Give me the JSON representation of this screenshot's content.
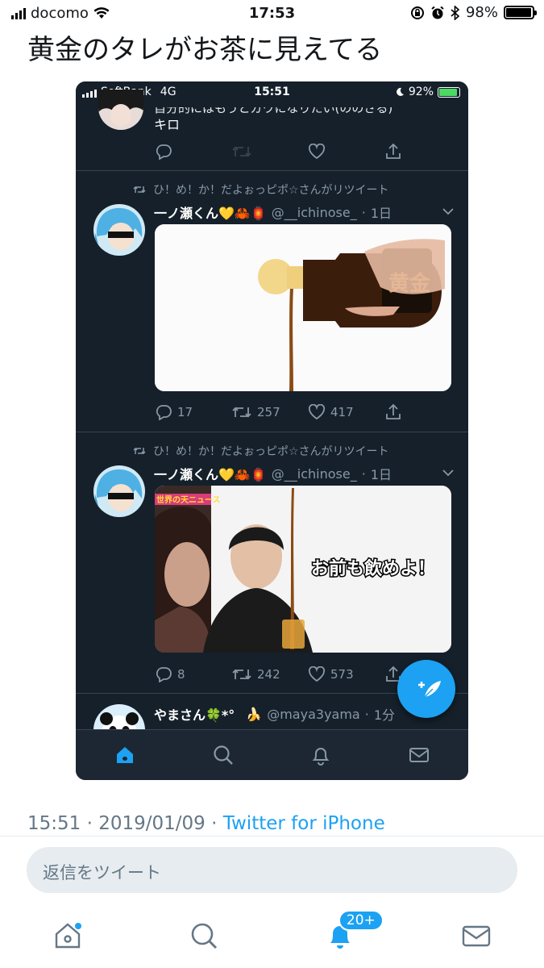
{
  "status_bar": {
    "carrier": "docomo",
    "time": "17:53",
    "battery": "98%",
    "battery_level": 0.98
  },
  "tweet": {
    "text": "黄金のタレがお茶に見えてる"
  },
  "screenshot": {
    "status": {
      "carrier": "SoftBank",
      "network": "4G",
      "time": "15:51",
      "battery": "92%",
      "battery_level": 0.92
    },
    "prev_tweet": {
      "text": "キロ",
      "cut_text": "自分的にはもうとガウになりたい(ののさる)"
    },
    "tweets": [
      {
        "retweeted_by": "ひ！め！か！だよぉっピポ☆さんがリツイート",
        "name": "一ノ瀬くん💛🦀🏮",
        "handle": "@__ichinose_",
        "time": "1日",
        "replies": "17",
        "retweets": "257",
        "likes": "417"
      },
      {
        "retweeted_by": "ひ！め！か！だよぉっピポ☆さんがリツイート",
        "name": "一ノ瀬くん💛🦀🏮",
        "handle": "@__ichinose_",
        "time": "1日",
        "replies": "8",
        "retweets": "242",
        "likes": "573",
        "caption": "お前も飲めよ！",
        "tv_logo": "世界の天ニュース"
      },
      {
        "name": "やまさん🍀*°",
        "emoji": "🍌",
        "handle": "@maya3yama",
        "time": "1分"
      }
    ],
    "label_brand": "黄金"
  },
  "meta": {
    "time": "15:51",
    "sep": "·",
    "date": "2019/01/09",
    "source": "Twitter for iPhone"
  },
  "reply": {
    "placeholder": "返信をツイート"
  },
  "nav": {
    "badge": "20+"
  }
}
